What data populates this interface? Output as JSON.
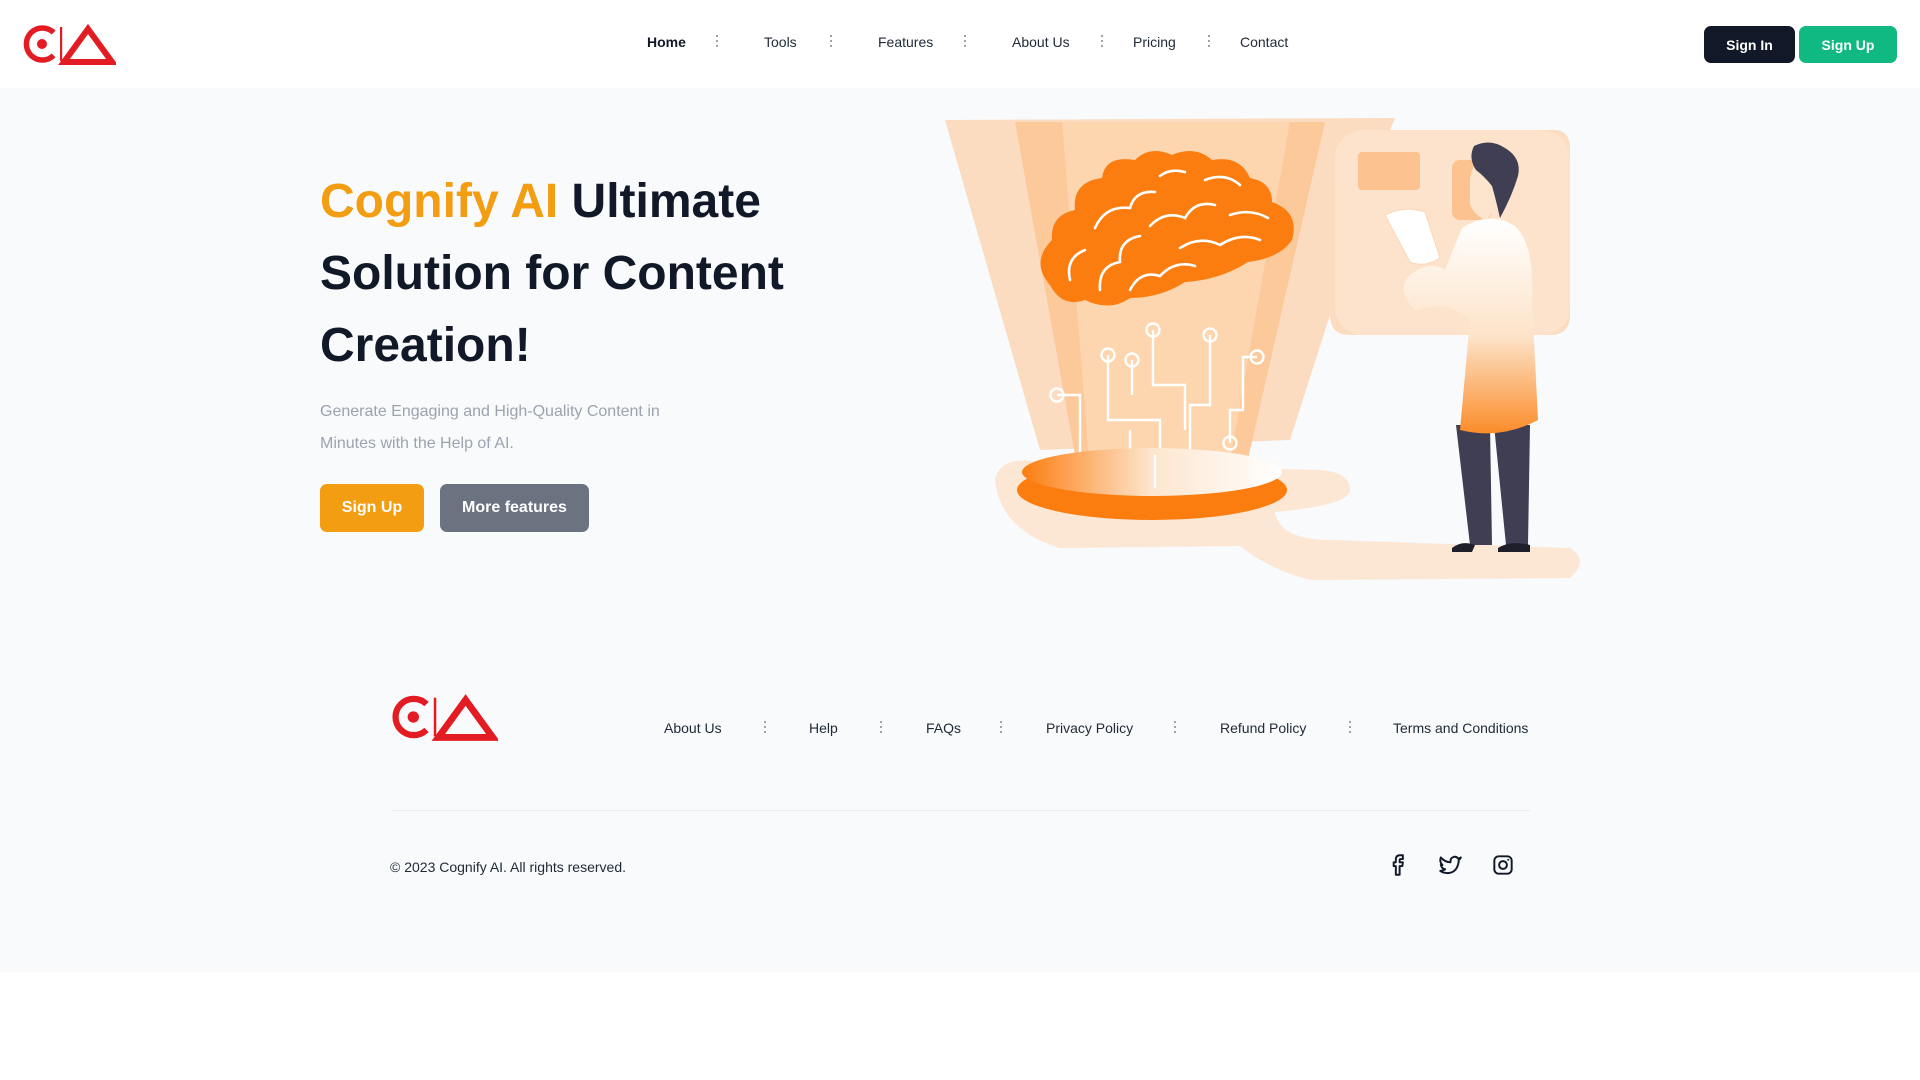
{
  "header": {
    "nav": [
      {
        "label": "Home",
        "active": true
      },
      {
        "label": "Tools"
      },
      {
        "label": "Features"
      },
      {
        "label": "About Us"
      },
      {
        "label": "Pricing"
      },
      {
        "label": "Contact"
      }
    ],
    "signin_label": "Sign In",
    "signup_label": "Sign Up"
  },
  "hero": {
    "title_accent": "Cognify AI",
    "title_rest": " Ultimate Solution for Content Creation!",
    "subtitle": "Generate Engaging and High-Quality Content in Minutes with the Help of AI.",
    "signup_label": "Sign Up",
    "more_label": "More features"
  },
  "footer": {
    "links": [
      {
        "label": "About Us"
      },
      {
        "label": "Help"
      },
      {
        "label": "FAQs"
      },
      {
        "label": "Privacy Policy"
      },
      {
        "label": "Refund Policy"
      },
      {
        "label": "Terms and Conditions"
      }
    ],
    "copyright": "© 2023 Cognify AI. All rights reserved.",
    "social": [
      "facebook-icon",
      "twitter-icon",
      "instagram-icon"
    ]
  },
  "colors": {
    "brand_red": "#e31b23",
    "accent_orange": "#f29d12",
    "signup_green": "#10b981",
    "dark": "#111827",
    "gray_button": "#6b7280"
  }
}
